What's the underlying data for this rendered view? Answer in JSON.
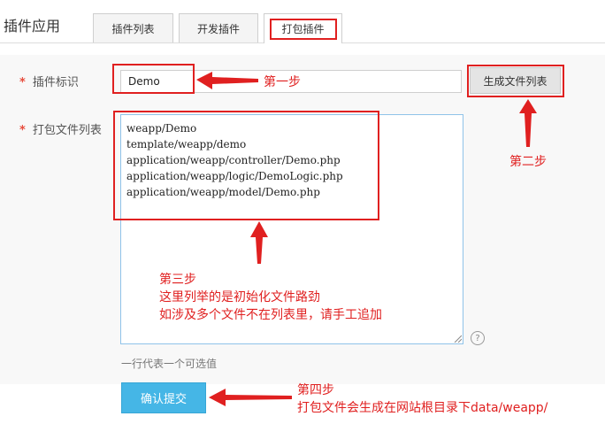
{
  "page_title": "插件应用",
  "tabs": [
    {
      "label": "插件列表",
      "active": false
    },
    {
      "label": "开发插件",
      "active": false
    },
    {
      "label": "打包插件",
      "active": true
    }
  ],
  "form": {
    "plugin_id_label": "插件标识",
    "plugin_id_value": "Demo",
    "generate_button": "生成文件列表",
    "file_list_label": "打包文件列表",
    "file_list_lines": [
      "weapp/Demo",
      "template/weapp/demo",
      "application/weapp/controller/Demo.php",
      "application/weapp/logic/DemoLogic.php",
      "application/weapp/model/Demo.php"
    ],
    "help_icon": "?",
    "hint": "一行代表一个可选值",
    "submit_button": "确认提交",
    "required_mark": "*"
  },
  "annotations": {
    "step1": "第一步",
    "step2": "第二步",
    "step3_lines": [
      "第三步",
      "这里列举的是初始化文件路劲",
      "如涉及多个文件不在列表里，请手工追加"
    ],
    "step4_lines": [
      "第四步",
      "打包文件会生成在网站根目录下data/weapp/"
    ]
  },
  "colors": {
    "annotation_red": "#e02020",
    "submit_blue": "#45b6e6",
    "textarea_border": "#8fc3e9"
  }
}
